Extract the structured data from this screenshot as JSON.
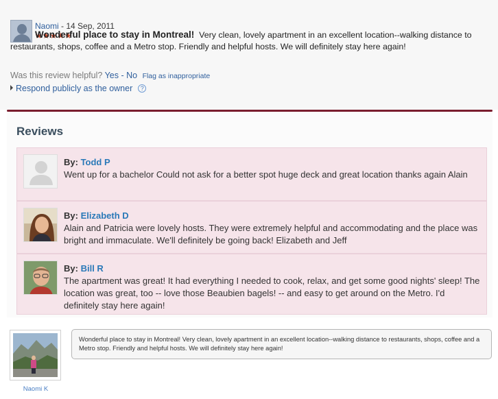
{
  "top_review": {
    "reviewer_name": "Naomi",
    "date": "- 14 Sep, 2011",
    "stars": "★★★★★",
    "title": "Wonderful place to stay in Montreal!",
    "body": "Very clean, lovely apartment in an excellent location--walking distance to restaurants, shops, coffee and a Metro stop. Friendly and helpful hosts. We will definitely stay here again!",
    "helpful_question": "Was this review helpful?",
    "yes_label": "Yes",
    "separator": " - ",
    "no_label": "No",
    "flag_label": "Flag as inappropriate",
    "respond_label": "Respond publicly as the owner",
    "help_icon": "?"
  },
  "reviews": {
    "heading": "Reviews",
    "by_label": "By:",
    "items": [
      {
        "author": "Todd P",
        "text": "Went up for a bachelor Could not ask for a better spot huge deck and great location thanks again Alain"
      },
      {
        "author": "Elizabeth D",
        "text": "Alain and Patricia were lovely hosts. They were extremely helpful and accommodating and the place was bright and immaculate. We'll definitely be going back! Elizabeth and Jeff"
      },
      {
        "author": "Bill R",
        "text": "The apartment was great! It had everything I needed to cook, relax, and get some good nights' sleep! The location was great, too -- love those Beaubien bagels! -- and easy to get around on the Metro. I'd definitely stay here again!"
      }
    ]
  },
  "bottom": {
    "photo_caption": "Naomi K",
    "bubble_text": "Wonderful place to stay in Montreal! Very clean, lovely apartment in an excellent location--walking distance to restaurants, shops, coffee and a Metro stop. Friendly and helpful hosts. We will definitely stay here again!"
  },
  "colors": {
    "star": "#c24a2d",
    "link": "#2e5e9c",
    "divider": "#7a1d2e",
    "card_bg": "#f6e4ea",
    "author_link": "#2a79b8"
  }
}
